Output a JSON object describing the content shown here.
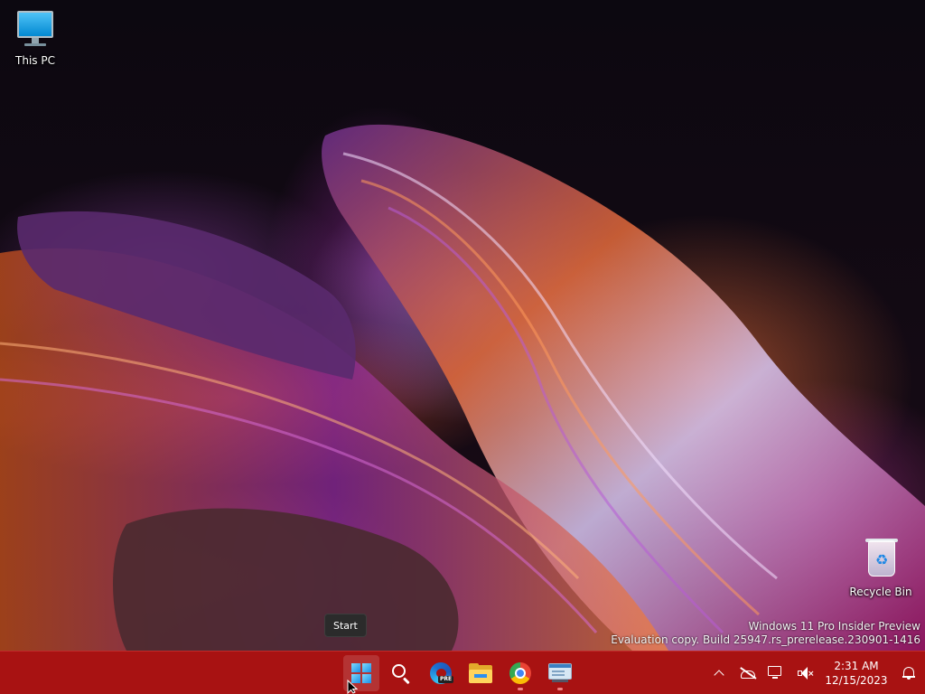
{
  "desktop": {
    "icons": [
      {
        "label": "This PC",
        "icon": "computer-icon"
      },
      {
        "label": "Recycle Bin",
        "icon": "recycle-bin-icon"
      }
    ],
    "watermark": {
      "line1": "Windows 11 Pro Insider Preview",
      "line2": "Evaluation copy. Build 25947.rs_prerelease.230901-1416"
    }
  },
  "tooltip": {
    "text": "Start"
  },
  "taskbar": {
    "background_color": "#a81212",
    "pinned": [
      {
        "name": "Start",
        "icon": "windows-logo-icon",
        "hovered": true
      },
      {
        "name": "Search",
        "icon": "search-icon"
      },
      {
        "name": "Microsoft Edge Preview",
        "icon": "edge-icon",
        "badge": "PRE"
      },
      {
        "name": "File Explorer",
        "icon": "folder-icon"
      },
      {
        "name": "Google Chrome",
        "icon": "chrome-icon",
        "running": true
      },
      {
        "name": "Remote Desktop",
        "icon": "window-app-icon",
        "running": true
      }
    ],
    "tray": {
      "icons": [
        "chevron-up-icon",
        "onedrive-offline-icon",
        "network-disconnected-icon",
        "volume-muted-icon"
      ],
      "time": "2:31 AM",
      "date": "12/15/2023",
      "notification_icon": "bell-icon"
    }
  }
}
